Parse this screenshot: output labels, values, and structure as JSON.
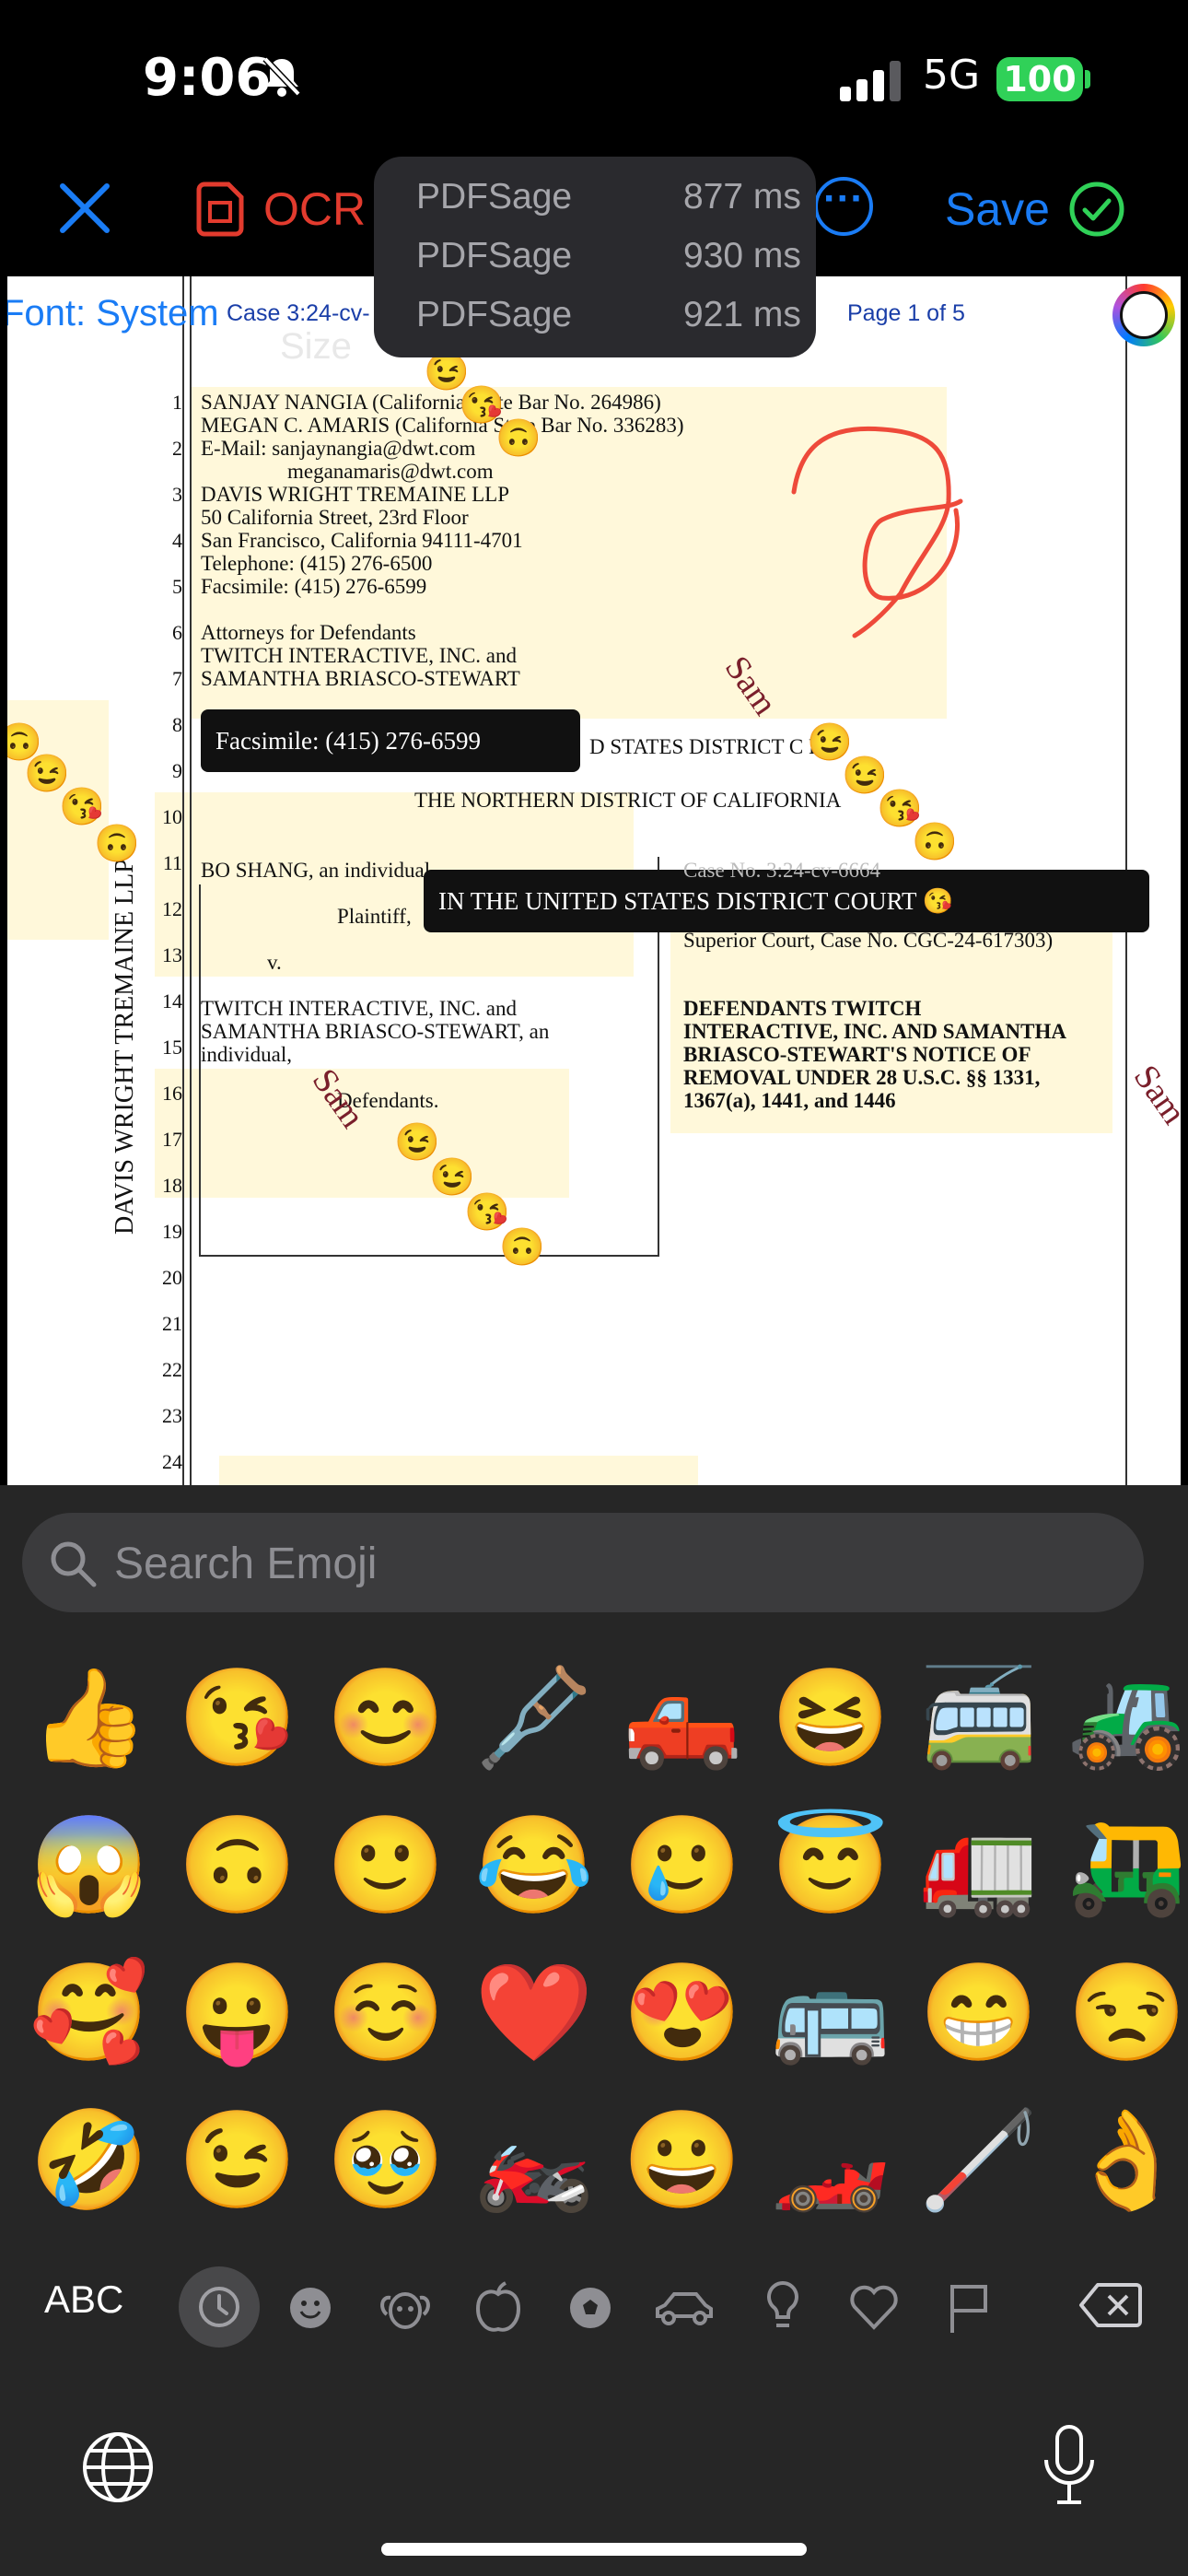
{
  "status": {
    "time": "9:06",
    "network": "5G",
    "battery": "100"
  },
  "toolbar": {
    "ocr_label": "OCR",
    "more_label": "···",
    "save_label": "Save"
  },
  "perf": [
    {
      "name": "PDFSage",
      "ms": "877 ms"
    },
    {
      "name": "PDFSage",
      "ms": "930 ms"
    },
    {
      "name": "PDFSage",
      "ms": "921 ms"
    }
  ],
  "doc": {
    "font_label": "Font: System",
    "case_header": "Case 3:24-cv-",
    "page_label": "Page 1 of 5",
    "size_fragment": "Size",
    "lines": [
      "SANJAY NANGIA (California State Bar No. 264986)",
      "MEGAN C. AMARIS (California State Bar No. 336283)",
      "E-Mail:  sanjaynangia@dwt.com",
      "meganamaris@dwt.com",
      "DAVIS WRIGHT TREMAINE LLP",
      "50 California Street, 23rd Floor",
      "San Francisco, California  94111-4701",
      "Telephone:       (415) 276-6500",
      "Facsimile:       (415) 276-6599",
      "Attorneys for Defendants",
      "TWITCH INTERACTIVE, INC. and",
      "SAMANTHA BRIASCO-STEWART"
    ],
    "fax_box": "Facsimile: (415) 276-6599",
    "district_line": "D STATES DISTRICT C   RT",
    "northern": "THE NORTHERN DISTRICT OF CALIFORNIA",
    "court_box": "IN THE UNITED STATES DISTRICT COURT 😘",
    "bo_shang": "BO SHANG, an individual",
    "plaintiff": "Plaintiff,",
    "v": "v.",
    "defendants_a": "TWITCH INTERACTIVE, INC. and",
    "defendants_b": "SAMANTHA BRIASCO-STEWART, an",
    "defendants_c": "individual,",
    "defendants_label": "Defendants.",
    "case_no": "Case No. 3:24-cv-6664",
    "superior": "Superior Court, Case No. CGC-24-617303)",
    "notice": [
      "DEFENDANTS TWITCH",
      "INTERACTIVE, INC. AND SAMANTHA",
      "BRIASCO-STEWART'S NOTICE OF",
      "REMOVAL UNDER 28 U.S.C. §§ 1331,",
      "1367(a), 1441, and 1446"
    ],
    "side_text": "DAVIS WRIGHT TREMAINE LLP",
    "sam": "Sam",
    "line_numbers": [
      "1",
      "2",
      "3",
      "4",
      "5",
      "6",
      "7",
      "8",
      "9",
      "10",
      "11",
      "12",
      "13",
      "14",
      "15",
      "16",
      "17",
      "18",
      "19",
      "20",
      "21",
      "22",
      "23",
      "24"
    ]
  },
  "keyboard": {
    "search_placeholder": "Search Emoji",
    "emoji_rows": [
      [
        "👍",
        "😘",
        "😊",
        "🩼",
        "🛻",
        "😆",
        "🚎",
        "🚜"
      ],
      [
        "😱",
        "🙃",
        "🙂",
        "😂",
        "🥲",
        "😇",
        "🚛",
        "🛺"
      ],
      [
        "🥰",
        "😛",
        "☺️",
        "❤️",
        "😍",
        "🚌",
        "😁",
        "😒"
      ],
      [
        "🤣",
        "😉",
        "🥹",
        "🏍️",
        "😀",
        "🏎️",
        "🦯",
        "👌"
      ]
    ],
    "abc_label": "ABC",
    "categories": [
      "clock-icon",
      "smiley-icon",
      "animal-icon",
      "food-icon",
      "ball-icon",
      "car-icon",
      "bulb-icon",
      "heart-icon",
      "flag-icon"
    ]
  },
  "colors": {
    "accent": "#1a7cf5",
    "ocr": "#e23b2e",
    "battery": "#30d158",
    "sam": "#7a1f2b"
  }
}
